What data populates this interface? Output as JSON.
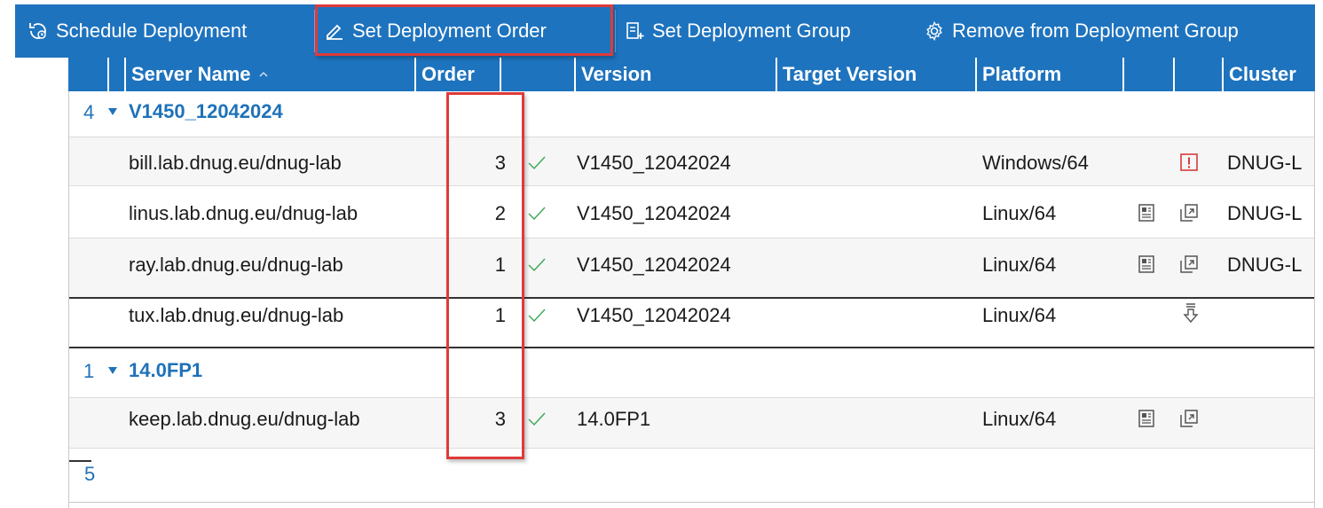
{
  "toolbar": {
    "schedule_label": "Schedule Deployment",
    "order_label": "Set Deployment Order",
    "group_label": "Set Deployment Group",
    "remove_label": "Remove from Deployment Group"
  },
  "columns": {
    "server_name": "Server Name",
    "order": "Order",
    "version": "Version",
    "target_version": "Target Version",
    "platform": "Platform",
    "cluster": "Cluster"
  },
  "groups": [
    {
      "count": "4",
      "name": "V1450_12042024",
      "rows": [
        {
          "server": "bill.lab.dnug.eu/dnug-lab",
          "order": "3",
          "version": "V1450_12042024",
          "platform": "Windows/64",
          "cluster": "DNUG-L"
        },
        {
          "server": "linus.lab.dnug.eu/dnug-lab",
          "order": "2",
          "version": "V1450_12042024",
          "platform": "Linux/64",
          "cluster": "DNUG-L"
        },
        {
          "server": "ray.lab.dnug.eu/dnug-lab",
          "order": "1",
          "version": "V1450_12042024",
          "platform": "Linux/64",
          "cluster": "DNUG-L"
        },
        {
          "server": "tux.lab.dnug.eu/dnug-lab",
          "order": "1",
          "version": "V1450_12042024",
          "platform": "Linux/64",
          "cluster": ""
        }
      ]
    },
    {
      "count": "1",
      "name": "14.0FP1",
      "rows": [
        {
          "server": "keep.lab.dnug.eu/dnug-lab",
          "order": "3",
          "version": "14.0FP1",
          "platform": "Linux/64",
          "cluster": ""
        }
      ]
    }
  ],
  "footer": {
    "total": "5"
  },
  "colors": {
    "toolbar_bg": "#1e73be",
    "group_text": "#1f72b8",
    "check": "#3aa655",
    "highlight": "#e03a3a",
    "warning": "#d83b3b"
  }
}
